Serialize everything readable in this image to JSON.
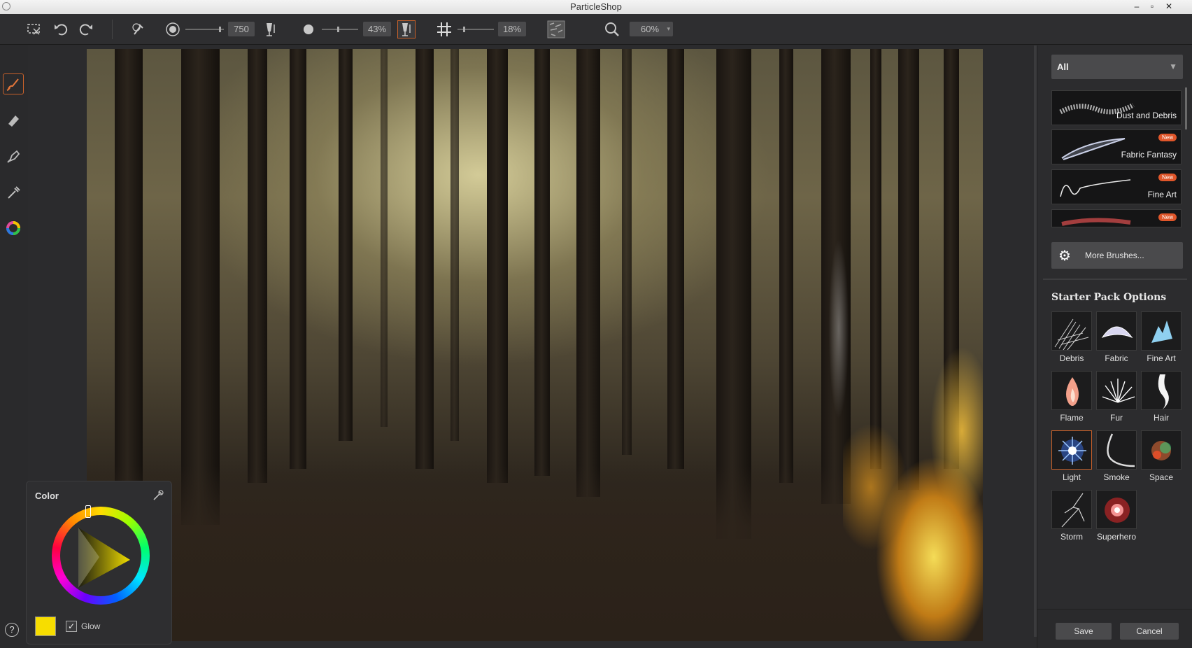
{
  "window": {
    "title": "ParticleShop",
    "controls": [
      "–",
      "▫",
      "✕"
    ]
  },
  "toolbar": {
    "size_value": "750",
    "opacity_value": "43%",
    "grid_value": "18%",
    "zoom_value": "60%"
  },
  "color_panel": {
    "title": "Color",
    "glow_label": "Glow",
    "glow_checked": true,
    "current_color": "#f7dd00"
  },
  "brush_panel": {
    "filter_value": "All",
    "brushes": [
      {
        "label": "Dust and Debris",
        "badge": ""
      },
      {
        "label": "Fabric Fantasy",
        "badge": "New"
      },
      {
        "label": "Fine Art",
        "badge": "New"
      },
      {
        "label": "",
        "badge": "New"
      }
    ],
    "more_label": "More Brushes...",
    "section_title": "Starter Pack Options",
    "options": [
      {
        "label": "Debris"
      },
      {
        "label": "Fabric"
      },
      {
        "label": "Fine Art"
      },
      {
        "label": "Flame"
      },
      {
        "label": "Fur"
      },
      {
        "label": "Hair"
      },
      {
        "label": "Light"
      },
      {
        "label": "Smoke"
      },
      {
        "label": "Space"
      },
      {
        "label": "Storm"
      },
      {
        "label": "Superhero"
      }
    ],
    "selected_option": "Light",
    "save_label": "Save",
    "cancel_label": "Cancel"
  },
  "help_label": "?",
  "colors": {
    "accent": "#c8612a",
    "new_badge": "#e0562a"
  }
}
